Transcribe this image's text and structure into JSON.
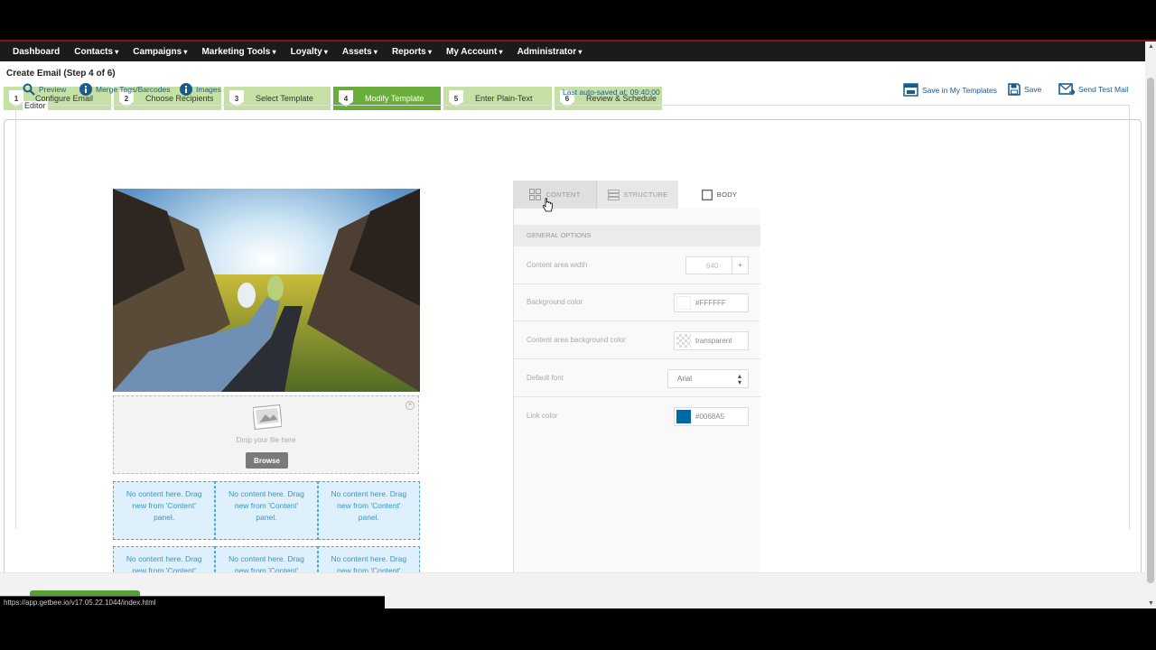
{
  "nav": [
    "Dashboard",
    "Contacts",
    "Campaigns",
    "Marketing Tools",
    "Loyalty",
    "Assets",
    "Reports",
    "My Account",
    "Administrator"
  ],
  "page_title": "Create Email (Step 4 of 6)",
  "steps": [
    {
      "num": "1",
      "label": "Configure Email"
    },
    {
      "num": "2",
      "label": "Choose Recipients"
    },
    {
      "num": "3",
      "label": "Select Template"
    },
    {
      "num": "4",
      "label": "Modify Template",
      "active": true
    },
    {
      "num": "5",
      "label": "Enter Plain-Text"
    },
    {
      "num": "6",
      "label": "Review & Schedule"
    }
  ],
  "toolbar": {
    "preview": "Preview",
    "merge_tags": "Merge Tags/Barcodes",
    "images": "Images",
    "autosave": "Last auto-saved at: 09:40:00",
    "save_my_templates": "Save in My Templates",
    "save": "Save",
    "send_test": "Send Test Mail"
  },
  "editor_legend": "Editor",
  "dropzone": {
    "text": "Drop your file here",
    "browse": "Browse"
  },
  "placeholder_text": "No content here. Drag new from 'Content' panel.",
  "panel": {
    "tabs": {
      "content": "CONTENT",
      "structure": "STRUCTURE",
      "body": "BODY"
    },
    "section": "GENERAL OPTIONS",
    "content_width_label": "Content area width",
    "content_width_value": "640",
    "bg_color_label": "Background color",
    "bg_color_value": "#FFFFFF",
    "content_bg_label": "Content area background color",
    "content_bg_value": "transparent",
    "font_label": "Default font",
    "font_value": "Arial",
    "link_color_label": "Link color",
    "link_color_value": "#0068A5"
  },
  "status_url": "https://app.getbee.io/v17.05.22.1044/index.html",
  "colors": {
    "step": "#c6e1a6",
    "step_active": "#6aad3d",
    "link": "#1a5b8e",
    "link_swatch": "#0068A5",
    "placeholder_bg": "#ddf0fb"
  }
}
